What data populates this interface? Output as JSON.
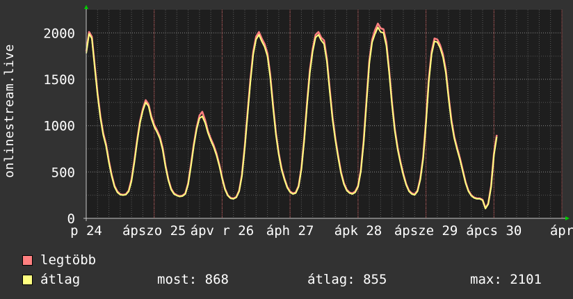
{
  "chart_data": {
    "type": "line",
    "ylabel": "onlinestream.live",
    "ylim": [
      0,
      2250
    ],
    "yticks": [
      0,
      500,
      1000,
      1500,
      2000
    ],
    "xlim": [
      0,
      168
    ],
    "xticks": [
      {
        "label": "p 24",
        "x": 0
      },
      {
        "label": "ápszo 25",
        "x": 24
      },
      {
        "label": "ápv",
        "x": 48
      },
      {
        "label": "r 26",
        "x": 48
      },
      {
        "label": "áph",
        "x": 72
      },
      {
        "label": "27",
        "x": 72
      },
      {
        "label": "ápk",
        "x": 96
      },
      {
        "label": "28",
        "x": 96
      },
      {
        "label": "ápsze 29",
        "x": 120
      },
      {
        "label": "ápcs",
        "x": 144
      },
      {
        "label": "30",
        "x": 144
      },
      {
        "label": "ápr",
        "x": 168
      }
    ],
    "grid": true,
    "series": [
      {
        "name": "legtöbb",
        "color": "#ff8080",
        "points": [
          [
            0,
            1800
          ],
          [
            1,
            2010
          ],
          [
            2,
            1960
          ],
          [
            3,
            1650
          ],
          [
            4,
            1350
          ],
          [
            5,
            1100
          ],
          [
            6,
            920
          ],
          [
            7,
            800
          ],
          [
            8,
            620
          ],
          [
            9,
            470
          ],
          [
            10,
            350
          ],
          [
            11,
            290
          ],
          [
            12,
            260
          ],
          [
            13,
            255
          ],
          [
            14,
            260
          ],
          [
            15,
            300
          ],
          [
            16,
            420
          ],
          [
            17,
            620
          ],
          [
            18,
            850
          ],
          [
            19,
            1050
          ],
          [
            20,
            1180
          ],
          [
            21,
            1275
          ],
          [
            22,
            1230
          ],
          [
            23,
            1100
          ],
          [
            24,
            1010
          ],
          [
            25,
            950
          ],
          [
            26,
            880
          ],
          [
            27,
            760
          ],
          [
            28,
            570
          ],
          [
            29,
            420
          ],
          [
            30,
            320
          ],
          [
            31,
            270
          ],
          [
            32,
            250
          ],
          [
            33,
            240
          ],
          [
            34,
            245
          ],
          [
            35,
            270
          ],
          [
            36,
            380
          ],
          [
            37,
            580
          ],
          [
            38,
            800
          ],
          [
            39,
            980
          ],
          [
            40,
            1110
          ],
          [
            41,
            1150
          ],
          [
            42,
            1060
          ],
          [
            43,
            940
          ],
          [
            44,
            860
          ],
          [
            45,
            790
          ],
          [
            46,
            700
          ],
          [
            47,
            580
          ],
          [
            48,
            440
          ],
          [
            49,
            320
          ],
          [
            50,
            250
          ],
          [
            51,
            220
          ],
          [
            52,
            215
          ],
          [
            53,
            230
          ],
          [
            54,
            300
          ],
          [
            55,
            470
          ],
          [
            56,
            780
          ],
          [
            57,
            1150
          ],
          [
            58,
            1500
          ],
          [
            59,
            1800
          ],
          [
            60,
            1960
          ],
          [
            61,
            2010
          ],
          [
            62,
            1940
          ],
          [
            63,
            1880
          ],
          [
            64,
            1780
          ],
          [
            65,
            1550
          ],
          [
            66,
            1220
          ],
          [
            67,
            920
          ],
          [
            68,
            700
          ],
          [
            69,
            540
          ],
          [
            70,
            430
          ],
          [
            71,
            340
          ],
          [
            72,
            290
          ],
          [
            73,
            270
          ],
          [
            74,
            280
          ],
          [
            75,
            350
          ],
          [
            76,
            540
          ],
          [
            77,
            860
          ],
          [
            78,
            1250
          ],
          [
            79,
            1600
          ],
          [
            80,
            1830
          ],
          [
            81,
            1980
          ],
          [
            82,
            2010
          ],
          [
            83,
            1950
          ],
          [
            84,
            1920
          ],
          [
            85,
            1720
          ],
          [
            86,
            1400
          ],
          [
            87,
            1090
          ],
          [
            88,
            860
          ],
          [
            89,
            670
          ],
          [
            90,
            500
          ],
          [
            91,
            380
          ],
          [
            92,
            310
          ],
          [
            93,
            280
          ],
          [
            94,
            270
          ],
          [
            95,
            290
          ],
          [
            96,
            350
          ],
          [
            97,
            520
          ],
          [
            98,
            840
          ],
          [
            99,
            1280
          ],
          [
            100,
            1700
          ],
          [
            101,
            1930
          ],
          [
            102,
            2030
          ],
          [
            103,
            2101
          ],
          [
            104,
            2050
          ],
          [
            105,
            2040
          ],
          [
            106,
            1900
          ],
          [
            107,
            1600
          ],
          [
            108,
            1250
          ],
          [
            109,
            960
          ],
          [
            110,
            760
          ],
          [
            111,
            610
          ],
          [
            112,
            480
          ],
          [
            113,
            370
          ],
          [
            114,
            300
          ],
          [
            115,
            270
          ],
          [
            116,
            260
          ],
          [
            117,
            300
          ],
          [
            118,
            430
          ],
          [
            119,
            660
          ],
          [
            120,
            1050
          ],
          [
            121,
            1500
          ],
          [
            122,
            1800
          ],
          [
            123,
            1940
          ],
          [
            124,
            1930
          ],
          [
            125,
            1870
          ],
          [
            126,
            1770
          ],
          [
            127,
            1600
          ],
          [
            128,
            1320
          ],
          [
            129,
            1060
          ],
          [
            130,
            880
          ],
          [
            131,
            760
          ],
          [
            132,
            650
          ],
          [
            133,
            520
          ],
          [
            134,
            390
          ],
          [
            135,
            300
          ],
          [
            136,
            250
          ],
          [
            137,
            225
          ],
          [
            138,
            215
          ],
          [
            139,
            215
          ],
          [
            140,
            200
          ],
          [
            141,
            110
          ],
          [
            142,
            160
          ],
          [
            143,
            350
          ],
          [
            144,
            700
          ],
          [
            145,
            900
          ]
        ]
      },
      {
        "name": "átlag",
        "color": "#ffff80",
        "points": [
          [
            0,
            1780
          ],
          [
            1,
            1990
          ],
          [
            2,
            1940
          ],
          [
            3,
            1630
          ],
          [
            4,
            1330
          ],
          [
            5,
            1080
          ],
          [
            6,
            900
          ],
          [
            7,
            780
          ],
          [
            8,
            600
          ],
          [
            9,
            455
          ],
          [
            10,
            340
          ],
          [
            11,
            280
          ],
          [
            12,
            255
          ],
          [
            13,
            250
          ],
          [
            14,
            255
          ],
          [
            15,
            290
          ],
          [
            16,
            400
          ],
          [
            17,
            600
          ],
          [
            18,
            830
          ],
          [
            19,
            1030
          ],
          [
            20,
            1160
          ],
          [
            21,
            1250
          ],
          [
            22,
            1210
          ],
          [
            23,
            1080
          ],
          [
            24,
            990
          ],
          [
            25,
            930
          ],
          [
            26,
            860
          ],
          [
            27,
            740
          ],
          [
            28,
            555
          ],
          [
            29,
            410
          ],
          [
            30,
            310
          ],
          [
            31,
            262
          ],
          [
            32,
            245
          ],
          [
            33,
            235
          ],
          [
            34,
            240
          ],
          [
            35,
            262
          ],
          [
            36,
            365
          ],
          [
            37,
            560
          ],
          [
            38,
            780
          ],
          [
            39,
            960
          ],
          [
            40,
            1080
          ],
          [
            41,
            1100
          ],
          [
            42,
            1030
          ],
          [
            43,
            920
          ],
          [
            44,
            840
          ],
          [
            45,
            770
          ],
          [
            46,
            680
          ],
          [
            47,
            565
          ],
          [
            48,
            430
          ],
          [
            49,
            312
          ],
          [
            50,
            245
          ],
          [
            51,
            215
          ],
          [
            52,
            210
          ],
          [
            53,
            225
          ],
          [
            54,
            290
          ],
          [
            55,
            455
          ],
          [
            56,
            760
          ],
          [
            57,
            1120
          ],
          [
            58,
            1470
          ],
          [
            59,
            1770
          ],
          [
            60,
            1930
          ],
          [
            61,
            1980
          ],
          [
            62,
            1910
          ],
          [
            63,
            1850
          ],
          [
            64,
            1750
          ],
          [
            65,
            1520
          ],
          [
            66,
            1195
          ],
          [
            67,
            900
          ],
          [
            68,
            685
          ],
          [
            69,
            525
          ],
          [
            70,
            418
          ],
          [
            71,
            330
          ],
          [
            72,
            282
          ],
          [
            73,
            262
          ],
          [
            74,
            272
          ],
          [
            75,
            340
          ],
          [
            76,
            525
          ],
          [
            77,
            840
          ],
          [
            78,
            1225
          ],
          [
            79,
            1570
          ],
          [
            80,
            1800
          ],
          [
            81,
            1950
          ],
          [
            82,
            1980
          ],
          [
            83,
            1920
          ],
          [
            84,
            1880
          ],
          [
            85,
            1690
          ],
          [
            86,
            1370
          ],
          [
            87,
            1065
          ],
          [
            88,
            840
          ],
          [
            89,
            650
          ],
          [
            90,
            485
          ],
          [
            91,
            368
          ],
          [
            92,
            300
          ],
          [
            93,
            272
          ],
          [
            94,
            262
          ],
          [
            95,
            280
          ],
          [
            96,
            340
          ],
          [
            97,
            505
          ],
          [
            98,
            815
          ],
          [
            99,
            1250
          ],
          [
            100,
            1670
          ],
          [
            101,
            1900
          ],
          [
            102,
            1990
          ],
          [
            103,
            2060
          ],
          [
            104,
            2010
          ],
          [
            105,
            2000
          ],
          [
            106,
            1860
          ],
          [
            107,
            1570
          ],
          [
            108,
            1225
          ],
          [
            109,
            940
          ],
          [
            110,
            740
          ],
          [
            111,
            595
          ],
          [
            112,
            465
          ],
          [
            113,
            360
          ],
          [
            114,
            292
          ],
          [
            115,
            262
          ],
          [
            116,
            252
          ],
          [
            117,
            290
          ],
          [
            118,
            415
          ],
          [
            119,
            640
          ],
          [
            120,
            1020
          ],
          [
            121,
            1470
          ],
          [
            122,
            1770
          ],
          [
            123,
            1910
          ],
          [
            124,
            1900
          ],
          [
            125,
            1840
          ],
          [
            126,
            1740
          ],
          [
            127,
            1570
          ],
          [
            128,
            1290
          ],
          [
            129,
            1035
          ],
          [
            130,
            860
          ],
          [
            131,
            740
          ],
          [
            132,
            632
          ],
          [
            133,
            505
          ],
          [
            134,
            378
          ],
          [
            135,
            292
          ],
          [
            136,
            243
          ],
          [
            137,
            220
          ],
          [
            138,
            210
          ],
          [
            139,
            210
          ],
          [
            140,
            195
          ],
          [
            141,
            105
          ],
          [
            142,
            152
          ],
          [
            143,
            335
          ],
          [
            144,
            680
          ],
          [
            145,
            880
          ]
        ]
      }
    ]
  },
  "legend": [
    {
      "label": "legtöbb",
      "color": "#ff8080"
    },
    {
      "label": "átlag",
      "color": "#ffff80"
    }
  ],
  "stats": {
    "most": "most: 868",
    "atlag": "átlag: 855",
    "max": "max: 2101"
  }
}
